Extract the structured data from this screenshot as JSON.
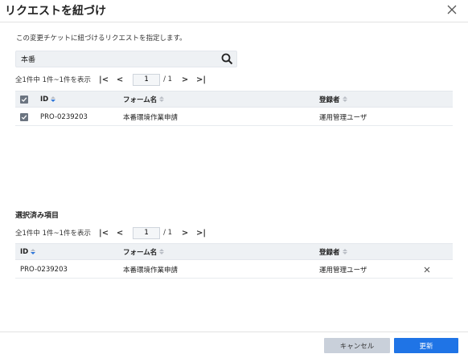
{
  "dialog": {
    "title": "リクエストを紐づけ"
  },
  "description": "この変更チケットに紐づけるリクエストを指定します。",
  "search": {
    "value": "本番"
  },
  "pager_top": {
    "count": "全1件中 1件~1件を表示",
    "page": "1",
    "total": "/ 1",
    "first": "|<",
    "prev": "<",
    "next": ">",
    "last": ">|"
  },
  "table": {
    "headers": {
      "id": "ID",
      "form": "フォーム名",
      "registrant": "登録者"
    },
    "rows": [
      {
        "checked": true,
        "id": "PRO-0239203",
        "form": "本番環境作業申請",
        "registrant": "運用管理ユーザ"
      }
    ]
  },
  "selected_section": {
    "title": "選択済み項目"
  },
  "pager_bottom": {
    "count": "全1件中 1件~1件を表示",
    "page": "1",
    "total": "/ 1",
    "first": "|<",
    "prev": "<",
    "next": ">",
    "last": ">|"
  },
  "selected_table": {
    "headers": {
      "id": "ID",
      "form": "フォーム名",
      "registrant": "登録者"
    },
    "rows": [
      {
        "id": "PRO-0239203",
        "form": "本番環境作業申請",
        "registrant": "運用管理ユーザ"
      }
    ]
  },
  "footer": {
    "cancel_label": "キャンセル",
    "update_label": "更新"
  },
  "icons": {
    "close": "close-icon",
    "search": "search-icon",
    "check": "checkbox-checked-icon",
    "remove": "remove-icon"
  },
  "colors": {
    "primary": "#1f74e6",
    "sort_active": "#2d76d9",
    "header_bg": "#eef1f4"
  }
}
